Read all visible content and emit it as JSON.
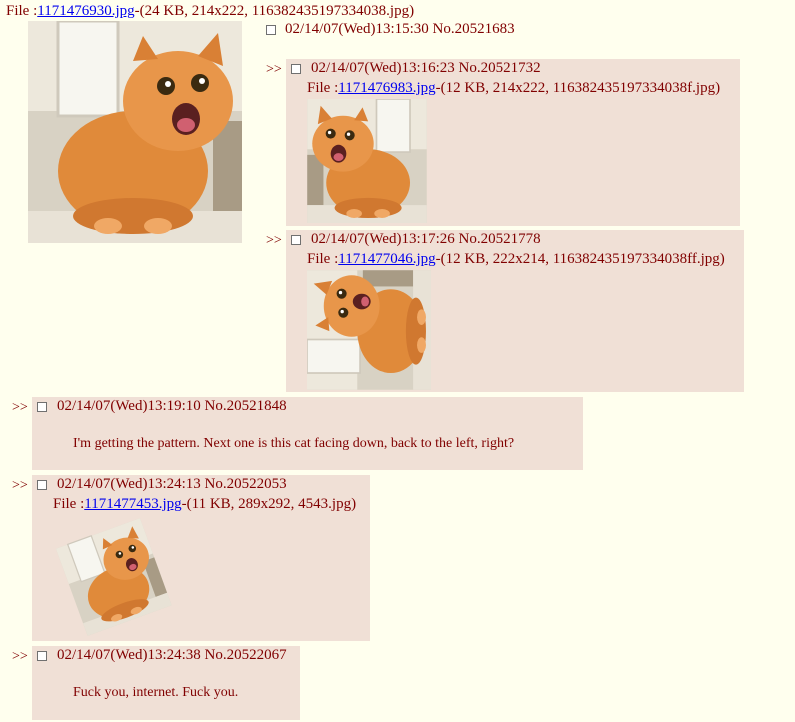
{
  "op": {
    "file_prefix": "File :",
    "filename": "1171476930.jpg",
    "file_info": "-(24 KB, 214x222, 116382435197334038.jpg)",
    "header": "02/14/07(Wed)13:15:30 No.20521683"
  },
  "replies": [
    {
      "arrow": ">>",
      "header": "02/14/07(Wed)13:16:23 No.20521732",
      "file_prefix": "File :",
      "filename": "1171476983.jpg",
      "file_info": "-(12 KB, 214x222, 116382435197334038f.jpg)"
    },
    {
      "arrow": ">>",
      "header": "02/14/07(Wed)13:17:26 No.20521778",
      "file_prefix": "File :",
      "filename": "1171477046.jpg",
      "file_info": "-(12 KB, 222x214, 116382435197334038ff.jpg)"
    },
    {
      "arrow": ">>",
      "header": "02/14/07(Wed)13:19:10 No.20521848",
      "message": "I'm getting the pattern. Next one is this cat facing down, back to the left, right?"
    },
    {
      "arrow": ">>",
      "header": "02/14/07(Wed)13:24:13 No.20522053",
      "file_prefix": "File :",
      "filename": "1171477453.jpg",
      "file_info": "-(11 KB, 289x292, 4543.jpg)"
    },
    {
      "arrow": ">>",
      "header": "02/14/07(Wed)13:24:38 No.20522067",
      "message": "Fuck you, internet. Fuck you."
    }
  ],
  "colors": {
    "background": "#FFFFEE",
    "reply_background": "#F0E0D6",
    "text": "#800000",
    "link": "#0000EE"
  },
  "thumbnails": {
    "subject": "orange-cat-icon"
  }
}
